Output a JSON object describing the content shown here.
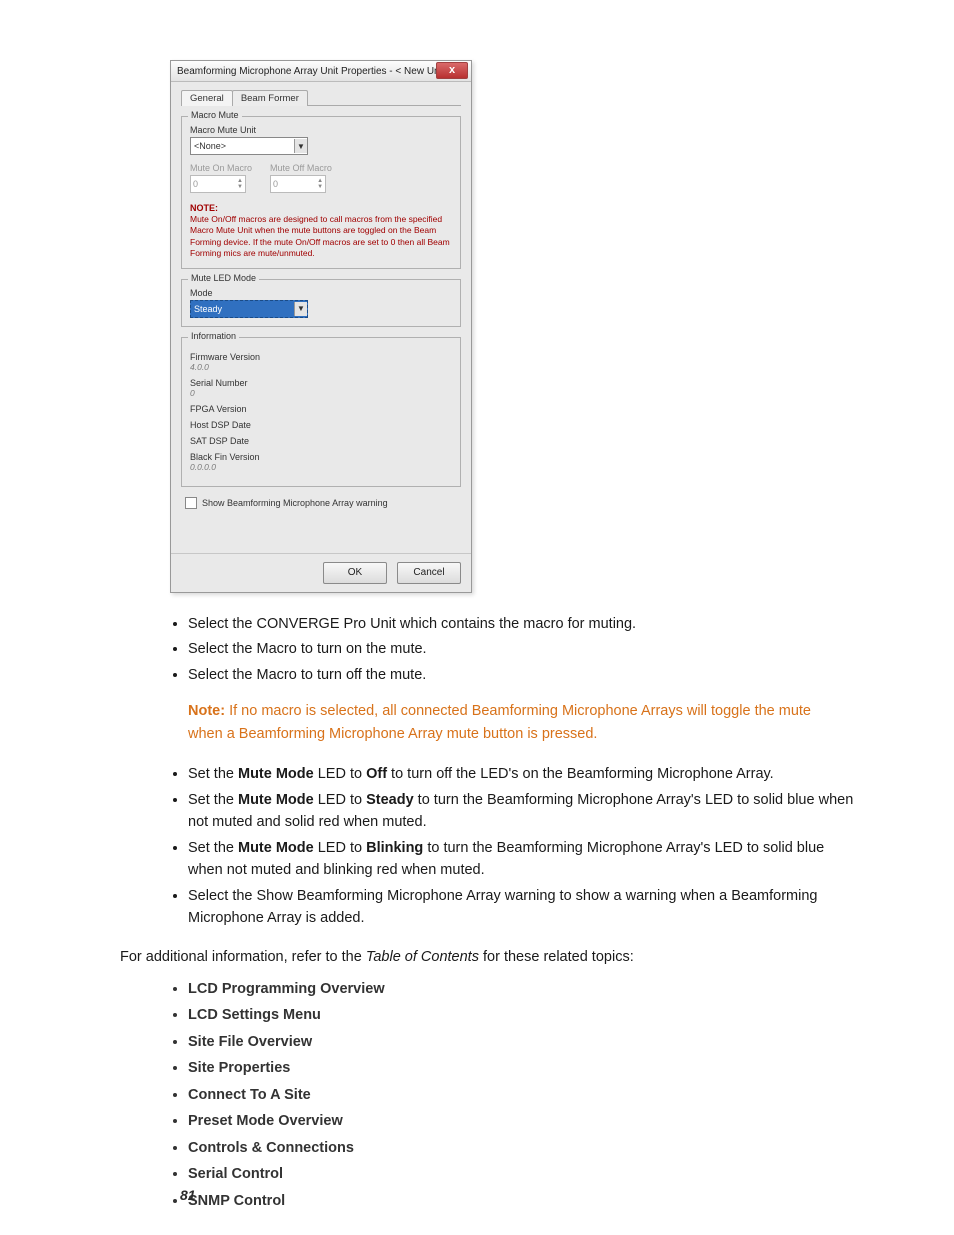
{
  "dialog": {
    "title": "Beamforming Microphone Array Unit Properties - < New Unit>",
    "close": "x",
    "tabs": {
      "general": "General",
      "beamformer": "Beam Former"
    },
    "macroMute": {
      "legend": "Macro Mute",
      "unitLabel": "Macro Mute Unit",
      "unitValue": "<None>",
      "muteOnLabel": "Mute On Macro",
      "muteOnValue": "0",
      "muteOffLabel": "Mute Off Macro",
      "muteOffValue": "0",
      "noteLabel": "NOTE:",
      "noteBody": "Mute On/Off macros are designed to call macros from the specified Macro Mute Unit when the mute buttons are toggled on the Beam Forming device. If the mute On/Off macros are set to 0 then all Beam Forming mics are mute/unmuted."
    },
    "muteLed": {
      "legend": "Mute LED Mode",
      "modeLabel": "Mode",
      "modeValue": "Steady"
    },
    "info": {
      "legend": "Information",
      "fwLabel": "Firmware Version",
      "fwVal": "4.0.0",
      "snLabel": "Serial Number",
      "snVal": "0",
      "fpgaLabel": "FPGA Version",
      "hostLabel": "Host DSP Date",
      "satLabel": "SAT DSP Date",
      "bfLabel": "Black Fin Version",
      "bfVal": "0.0.0.0"
    },
    "showWarning": "Show Beamforming Microphone Array warning",
    "ok": "OK",
    "cancel": "Cancel"
  },
  "doc": {
    "bullets1": [
      "Select the CONVERGE Pro Unit which contains the macro for muting.",
      "Select the Macro to turn on the mute.",
      "Select the Macro to turn off the mute."
    ],
    "note": {
      "label": "Note:",
      "text": "If no macro is selected, all connected Beamforming Microphone Arrays will toggle the mute when a Beamforming Microphone Array mute button is pressed."
    },
    "bullets2": {
      "b1_pre": "Set the ",
      "b1_bold1": "Mute Mode",
      "b1_mid": " LED to ",
      "b1_bold2": "Off",
      "b1_post": " to turn off the LED's on the Beamforming Microphone Array.",
      "b2_pre": "Set the ",
      "b2_bold1": "Mute Mode",
      "b2_mid": " LED to ",
      "b2_bold2": "Steady",
      "b2_post": " to turn the Beamforming Microphone Array's LED to solid blue when not muted and solid red when muted.",
      "b3_pre": "Set the ",
      "b3_bold1": "Mute Mode",
      "b3_mid": " LED to ",
      "b3_bold2": "Blinking",
      "b3_post": " to turn the Beamforming Microphone Array's LED to solid blue when not muted and blinking red when muted.",
      "b4": "Select the Show Beamforming Microphone Array warning to show a warning when a Beamforming Microphone Array is added."
    },
    "refText_pre": "For additional information, refer to the ",
    "refText_ital": "Table of Contents",
    "refText_post": " for these related topics:",
    "links": [
      "LCD Programming Overview",
      "LCD Settings Menu",
      "Site File Overview",
      "Site Properties",
      "Connect To A Site",
      "Preset Mode Overview",
      "Controls & Connections",
      "Serial Control",
      "SNMP Control"
    ],
    "pageNum": "81"
  }
}
